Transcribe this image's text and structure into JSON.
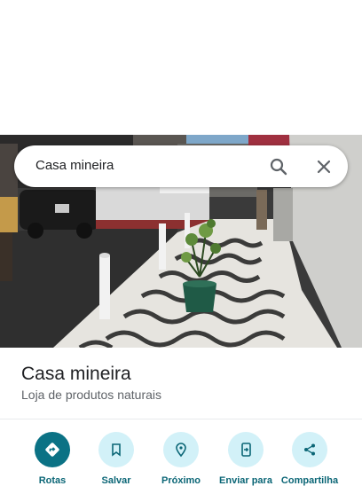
{
  "search": {
    "query": "Casa mineira"
  },
  "place": {
    "name": "Casa mineira",
    "category": "Loja de produtos naturais"
  },
  "actions": [
    {
      "label": "Rotas",
      "icon": "directions-icon"
    },
    {
      "label": "Salvar",
      "icon": "bookmark-icon"
    },
    {
      "label": "Próximo",
      "icon": "nearby-icon"
    },
    {
      "label": "Enviar para",
      "icon": "send-to-phone-icon"
    },
    {
      "label": "Compartilha",
      "icon": "share-icon"
    }
  ],
  "colors": {
    "accent": "#0b7285",
    "accent_light": "#d2f1f8",
    "label": "#0b6676"
  }
}
